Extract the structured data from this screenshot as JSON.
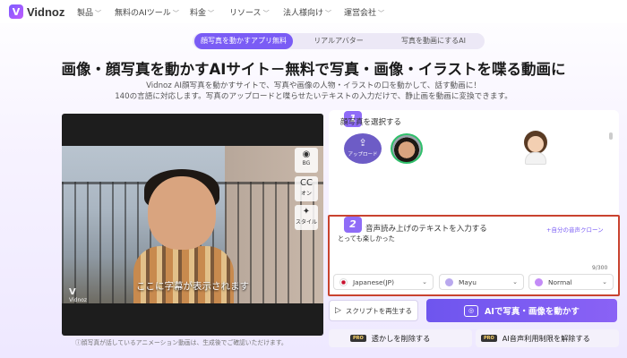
{
  "nav": {
    "logo": "Vidnoz",
    "items": [
      "製品",
      "無料のAIツール",
      "料金",
      "リソース",
      "法人様向け",
      "運営会社"
    ]
  },
  "tabs": [
    "顔写真を動かすアプリ無料",
    "リアルアバター",
    "写真を動画にするAI"
  ],
  "title": "画像・顔写真を動かすAIサイト－無料で写真・画像・イラストを喋る動画に",
  "description": [
    "Vidnoz AI顔写真を動かすサイトで、写真や画像の人物・イラストの口を動かして、話す動画に！",
    "140の言語に対応します。写真のアップロードと喋らせたいテキストの入力だけで、静止画を動画に変換できます。"
  ],
  "video": {
    "subtitle": "ここに字幕が表示されます",
    "watermark": "Vidnoz",
    "tools": [
      {
        "icon": "bg-icon",
        "glyph": "◉",
        "label": "BG"
      },
      {
        "icon": "cc-icon",
        "glyph": "CC",
        "label": "オン"
      },
      {
        "icon": "style-icon",
        "glyph": "✦",
        "label": "スタイル"
      }
    ],
    "note": "ⓘ顔写真が話しているアニメーション動画は、生成後でご確認いただけます。"
  },
  "step1": {
    "number": "1",
    "label": "顔写真を選択する",
    "upload": "アップロード"
  },
  "step2": {
    "number": "2",
    "label": "音声読み上げのテキストを入力する",
    "clone": "+自分の音声クローン",
    "text": "とっても楽しかった",
    "counter": "9/300",
    "language": "Japanese(JP)",
    "voice": "Mayu",
    "style": "Normal"
  },
  "actions": {
    "play_script": "スクリプトを再生する",
    "animate": "AIで写真・画像を動かす",
    "remove_watermark": "透かしを削除する",
    "unlimit": "AI音声利用制限を解除する",
    "pro": "PRO"
  },
  "colors": {
    "accent": "#7a5cf5",
    "highlight_border": "#c9432f",
    "selected_thumb": "#2fbf6a"
  }
}
